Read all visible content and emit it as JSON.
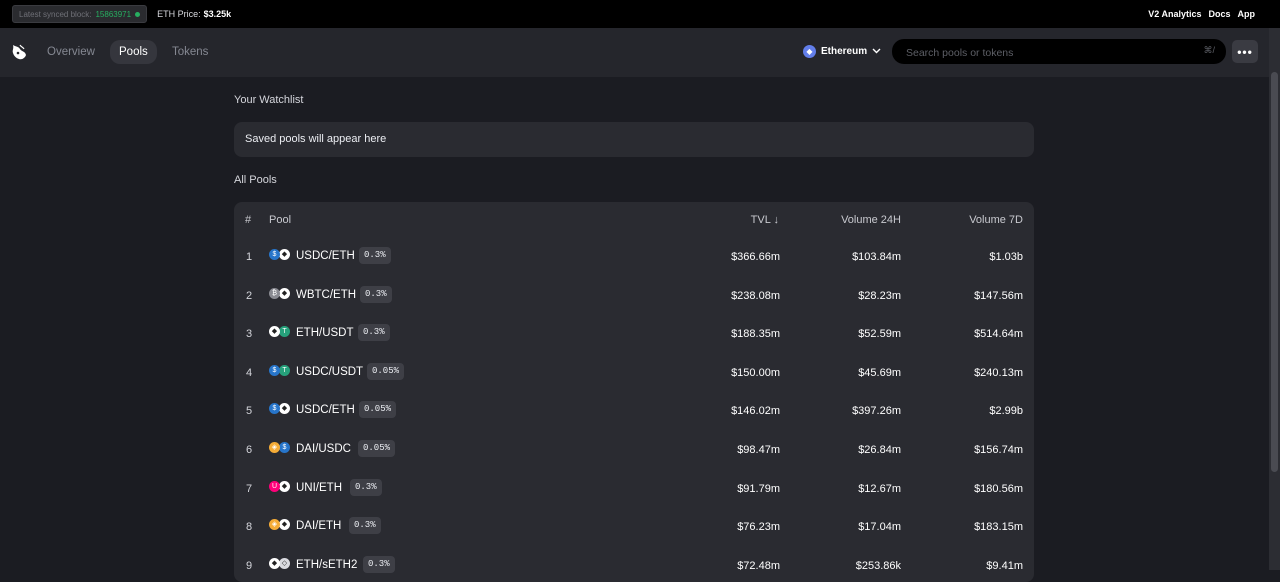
{
  "topbar": {
    "sync_label": "Latest synced block:",
    "block_number": "15863971",
    "eth_price_label": "ETH Price:",
    "eth_price_value": "$3.25k",
    "links": [
      "V2 Analytics",
      "Docs",
      "App"
    ]
  },
  "nav": {
    "tabs": [
      "Overview",
      "Pools",
      "Tokens"
    ],
    "active_tab": "Pools",
    "network": "Ethereum",
    "search_placeholder": "Search pools or tokens",
    "search_shortcut": "⌘/",
    "more_label": "•••"
  },
  "watchlist": {
    "title": "Your Watchlist",
    "empty_text": "Saved pools will appear here"
  },
  "all_pools": {
    "title": "All Pools",
    "columns": [
      "#",
      "Pool",
      "TVL ↓",
      "Volume 24H",
      "Volume 7D"
    ],
    "rows": [
      {
        "index": "1",
        "pair": "USDC/ETH",
        "fee": "0.3%",
        "tvl": "$366.66m",
        "vol24h": "$103.84m",
        "vol7d": "$1.03b",
        "coins": [
          "usdc",
          "eth"
        ]
      },
      {
        "index": "2",
        "pair": "WBTC/ETH",
        "fee": "0.3%",
        "tvl": "$238.08m",
        "vol24h": "$28.23m",
        "vol7d": "$147.56m",
        "coins": [
          "wbtc",
          "eth"
        ]
      },
      {
        "index": "3",
        "pair": "ETH/USDT",
        "fee": "0.3%",
        "tvl": "$188.35m",
        "vol24h": "$52.59m",
        "vol7d": "$514.64m",
        "coins": [
          "eth",
          "usdt"
        ]
      },
      {
        "index": "4",
        "pair": "USDC/USDT",
        "fee": "0.05%",
        "tvl": "$150.00m",
        "vol24h": "$45.69m",
        "vol7d": "$240.13m",
        "coins": [
          "usdc",
          "usdt"
        ]
      },
      {
        "index": "5",
        "pair": "USDC/ETH",
        "fee": "0.05%",
        "tvl": "$146.02m",
        "vol24h": "$397.26m",
        "vol7d": "$2.99b",
        "coins": [
          "usdc",
          "eth"
        ]
      },
      {
        "index": "6",
        "pair": "DAI/USDC",
        "fee": "0.05%",
        "tvl": "$98.47m",
        "vol24h": "$26.84m",
        "vol7d": "$156.74m",
        "coins": [
          "dai",
          "usdc"
        ]
      },
      {
        "index": "7",
        "pair": "UNI/ETH",
        "fee": "0.3%",
        "tvl": "$91.79m",
        "vol24h": "$12.67m",
        "vol7d": "$180.56m",
        "coins": [
          "uni",
          "eth"
        ]
      },
      {
        "index": "8",
        "pair": "DAI/ETH",
        "fee": "0.3%",
        "tvl": "$76.23m",
        "vol24h": "$17.04m",
        "vol7d": "$183.15m",
        "coins": [
          "dai",
          "eth"
        ]
      },
      {
        "index": "9",
        "pair": "ETH/sETH2",
        "fee": "0.3%",
        "tvl": "$72.48m",
        "vol24h": "$253.86k",
        "vol7d": "$9.41m",
        "coins": [
          "eth",
          "seth2"
        ]
      }
    ]
  },
  "coin_colors": {
    "usdc": "#2775ca",
    "eth": "#ffffff",
    "wbtc": "#8a8b92",
    "usdt": "#26a17b",
    "dai": "#f5ac37",
    "uni": "#ff007a",
    "seth2": "#d9dadf"
  }
}
